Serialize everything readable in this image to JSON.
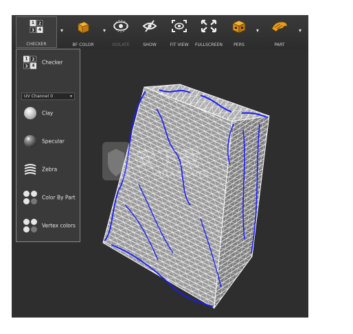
{
  "toolbar": {
    "items": [
      {
        "label": "CHECKER",
        "icon": "checker-icon",
        "active": true,
        "dropdown": true
      },
      {
        "label": "BF COLOR",
        "icon": "bf-color-cube-icon",
        "dropdown": true
      },
      {
        "label": "ISOLATE",
        "icon": "isolate-eye-icon",
        "dim": true
      },
      {
        "label": "SHOW",
        "icon": "show-hide-eye-icon"
      },
      {
        "label": "FIT VIEW",
        "icon": "fit-view-icon"
      },
      {
        "label": "FULLSCREEN",
        "icon": "fullscreen-icon"
      },
      {
        "label": "PERS",
        "icon": "perspective-cube-icon",
        "dropdown": true
      },
      {
        "label": "PART",
        "icon": "part-icon",
        "dropdown": true
      }
    ],
    "checker_numbers": [
      "1",
      "2",
      "3",
      "4"
    ]
  },
  "menu": {
    "checker": "Checker",
    "uv_channel": "UV Channel 0",
    "clay": "Clay",
    "specular": "Specular",
    "zebra": "Zebra",
    "color_by_part": "Color By Part",
    "vertex_colors": "Vertex colors"
  },
  "watermark": {
    "text": "安下载",
    "subtext": "anxz.com"
  },
  "colors": {
    "viewport_bg": "#2e2e2e",
    "mesh_wire": "#ffffff",
    "mesh_seam": "#1a1aff",
    "icon_orange": "#e8a020"
  }
}
